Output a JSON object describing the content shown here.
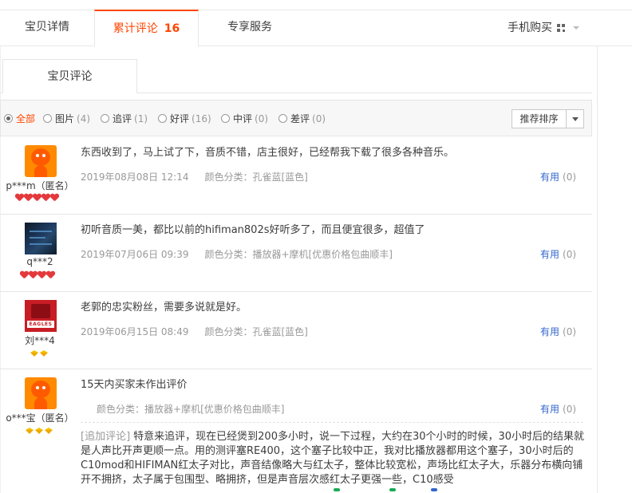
{
  "tabs": {
    "detail": "宝贝详情",
    "reviews_label": "累计评论",
    "reviews_count": "16",
    "service": "专享服务",
    "mobile_buy": "手机购买"
  },
  "subtab": {
    "label": "宝贝评论"
  },
  "filters": [
    {
      "label": "全部",
      "count": "",
      "selected": true
    },
    {
      "label": "图片",
      "count": "(4)",
      "selected": false
    },
    {
      "label": "追评",
      "count": "(1)",
      "selected": false
    },
    {
      "label": "好评",
      "count": "(16)",
      "selected": false
    },
    {
      "label": "中评",
      "count": "(0)",
      "selected": false
    },
    {
      "label": "差评",
      "count": "(0)",
      "selected": false
    }
  ],
  "sort": {
    "label": "推荐排序"
  },
  "reviews": [
    {
      "user": "p***m（匿名）",
      "content": "东西收到了，马上试了下，音质不错，店主很好，已经帮我下载了很多各种音乐。",
      "date": "2019年08月08日 12:14",
      "spec_label": "颜色分类：",
      "spec": "孔雀蓝[蓝色]",
      "useful_label": "有用",
      "useful_count": "(0)"
    },
    {
      "user": "q***2",
      "content": "初听音质一美，都比以前的hifiman802s好听多了，而且便宜很多，超值了",
      "date": "2019年07月06日 09:39",
      "spec_label": "颜色分类：",
      "spec": "播放器+摩机[优惠价格包曲顺丰]",
      "useful_label": "有用",
      "useful_count": "(0)"
    },
    {
      "user": "刘***4",
      "content": "老郭的忠实粉丝，需要多说就是好。",
      "date": "2019年06月15日 08:49",
      "spec_label": "颜色分类：",
      "spec": "孔雀蓝[蓝色]",
      "useful_label": "有用",
      "useful_count": "(0)",
      "avatar_text": "EAGLES"
    },
    {
      "user": "o***宝（匿名）",
      "content": "15天内买家未作出评价",
      "spec_label": "颜色分类：",
      "spec": "播放器+摩机[优惠价格包曲顺丰]",
      "useful_label": "有用",
      "useful_count": "(0)",
      "append_tag": "[追加评论]",
      "append_text": "特意来追评，现在已经煲到200多小时，说一下过程，大约在30个小时的时候，30小时后的结果就是人声比开声更顺一点。用的测评塞RE400，这个塞子比较中正，我对比播放器都用这个塞子，30小时后的C10mod和HIFIMAN红太子对比，声音结像略大与红太子，整体比较宽松，声场比红太子大，乐器分布横向铺开不拥挤，太子属于包围型、略拥挤，但是声音层次感红太子更强一些，C10感受"
    }
  ],
  "colors": {
    "accent": "#ff4400",
    "link": "#3366cc",
    "muted": "#999999"
  }
}
